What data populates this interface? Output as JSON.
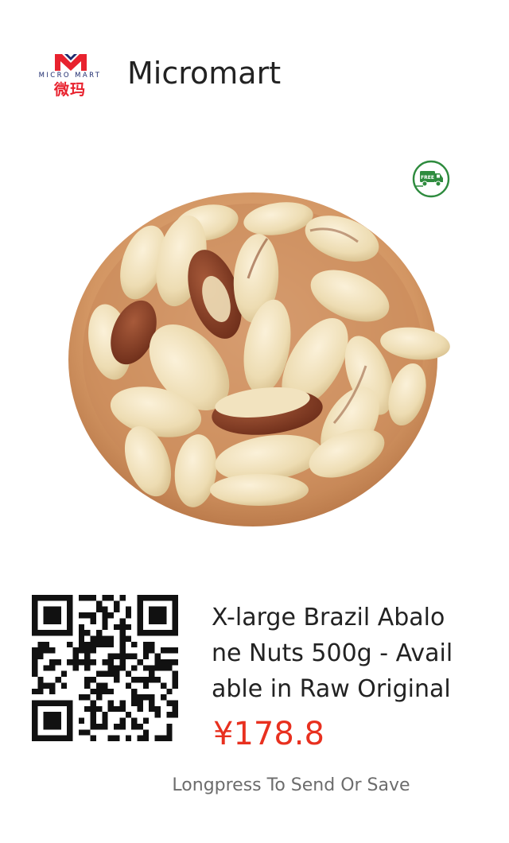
{
  "header": {
    "logo_text_en": "MICRO MART",
    "logo_text_cn": "微玛",
    "store_name": "Micromart"
  },
  "badge": {
    "text": "FREE",
    "icon": "delivery-truck-icon"
  },
  "product": {
    "image": "brazil-nuts-in-wooden-bowl",
    "title_lines": [
      "X-large Brazil Abalo",
      "ne Nuts 500g - Avail",
      "able in Raw Original"
    ],
    "price": "¥178.8"
  },
  "qr": {
    "icon": "qr-code-icon"
  },
  "footer": {
    "hint": "Longpress To Send Or Save"
  },
  "colors": {
    "price": "#e8301f",
    "brand_red": "#e8222e",
    "brand_blue": "#1e2b6e",
    "badge_green": "#2e8b3e"
  }
}
